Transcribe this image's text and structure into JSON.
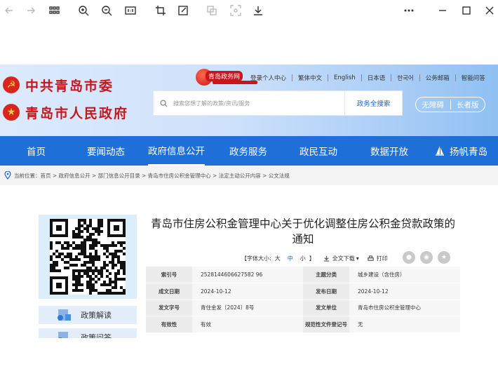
{
  "toolbar": {
    "buttons": [
      "back-icon",
      "forward-icon",
      "apps-grid-icon",
      "zoom-in-icon",
      "zoom-out-icon",
      "actual-size-icon",
      "crop-icon",
      "edit-icon",
      "copy-icon",
      "screenshot-icon",
      "download-icon",
      "more-icon",
      "minimize-icon",
      "maximize-icon",
      "close-icon"
    ]
  },
  "header": {
    "org_party": "中共青岛市委",
    "org_gov": "青岛市人民政府",
    "portal_name": "青岛政务网",
    "top_links": [
      "登录个人中心",
      "繁体中文",
      "English",
      "日本语",
      "한국어",
      "公务邮箱",
      "智能问答"
    ],
    "search": {
      "placeholder": "搜索您想了解的政策/资讯/服务",
      "button": "政务全搜索"
    },
    "access": [
      "无障碍",
      "长者版"
    ]
  },
  "nav": {
    "items": [
      "首页",
      "要闻动态",
      "政府信息公开",
      "政务服务",
      "政民互动",
      "数据开放",
      "扬帆青岛"
    ],
    "active": "政府信息公开"
  },
  "breadcrumb": {
    "label": "当前位置：",
    "path": "首页 > 政府信息公开 > 部门信息公开目录 > 青岛市住房公积金管理中心 > 法定主动公开内容 > 公文法规"
  },
  "sidebar": {
    "buttons": [
      "政策解读",
      "政策问答"
    ]
  },
  "document": {
    "title": "青岛市住房公积金管理中心关于优化调整住房公积金贷款政策的通知",
    "font_size_label": "【字体大小:",
    "font_sizes": [
      "大",
      "中",
      "小"
    ],
    "font_size_close": "】",
    "download_label": "全文下载",
    "print_label": "打印",
    "meta": [
      {
        "k1": "索引号",
        "v1": "2528144606627582 96",
        "k2": "主题分类",
        "v2": "城乡建设（含住房）"
      },
      {
        "k1": "成文日期",
        "v1": "2024-10-12",
        "k2": "发布日期",
        "v2": "2024-10-12"
      },
      {
        "k1": "发文字号",
        "v1": "青住金发〔2024〕8号",
        "k2": "发文单位",
        "v2": "青岛市住房公积金管理中心"
      },
      {
        "k1": "有效性",
        "v1": "有效",
        "k2": "规范性文件登记号",
        "v2": "无"
      }
    ]
  },
  "colors": {
    "nav": "#1f6fd8",
    "party_red": "#c8161d",
    "accent": "#1e64c8"
  }
}
